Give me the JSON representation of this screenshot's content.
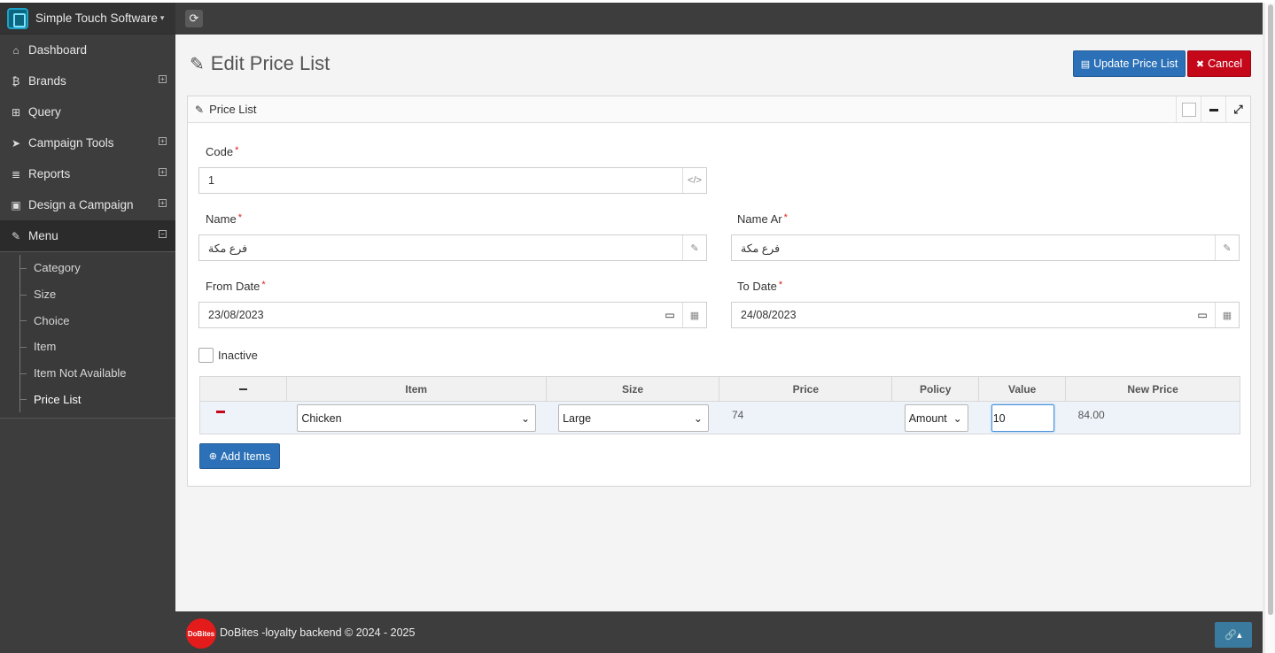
{
  "app": {
    "name": "Simple Touch Software"
  },
  "sidebar": {
    "items": [
      {
        "label": "Dashboard",
        "icon": "home-icon"
      },
      {
        "label": "Brands",
        "icon": "bitcoin-icon"
      },
      {
        "label": "Query",
        "icon": "sitemap-icon"
      },
      {
        "label": "Campaign Tools",
        "icon": "send-icon"
      },
      {
        "label": "Reports",
        "icon": "database-icon"
      },
      {
        "label": "Design a Campaign",
        "icon": "briefcase-icon"
      },
      {
        "label": "Menu",
        "icon": "edit-icon"
      }
    ],
    "menu_sub": [
      "Category",
      "Size",
      "Choice",
      "Item",
      "Item Not Available",
      "Price List"
    ]
  },
  "page": {
    "title": "Edit Price List",
    "update_label": "Update Price List",
    "cancel_label": "Cancel"
  },
  "panel": {
    "title": "Price List",
    "code_label": "Code",
    "code_value": "1",
    "name_label": "Name",
    "name_value": "فرع مكة",
    "name_ar_label": "Name Ar",
    "name_ar_value": "فرع مكة",
    "from_date_label": "From Date",
    "from_date_value": "23/08/2023",
    "to_date_label": "To Date",
    "to_date_value": "24/08/2023",
    "inactive_label": "Inactive",
    "inactive_checked": false,
    "add_items_label": "Add Items"
  },
  "table": {
    "headers": [
      "Item",
      "Size",
      "Price",
      "Policy",
      "Value",
      "New Price"
    ],
    "rows": [
      {
        "item": "Chicken",
        "size": "Large",
        "price": "74",
        "policy": "Amount",
        "value": "10",
        "new_price": "84.00"
      }
    ]
  },
  "footer": {
    "logo_text": "DoBites",
    "text": "DoBites -loyalty backend © 2024 - 2025"
  },
  "colors": {
    "primary": "#2c71b7",
    "danger": "#c5071a",
    "sidebar": "#3d3d3d"
  }
}
